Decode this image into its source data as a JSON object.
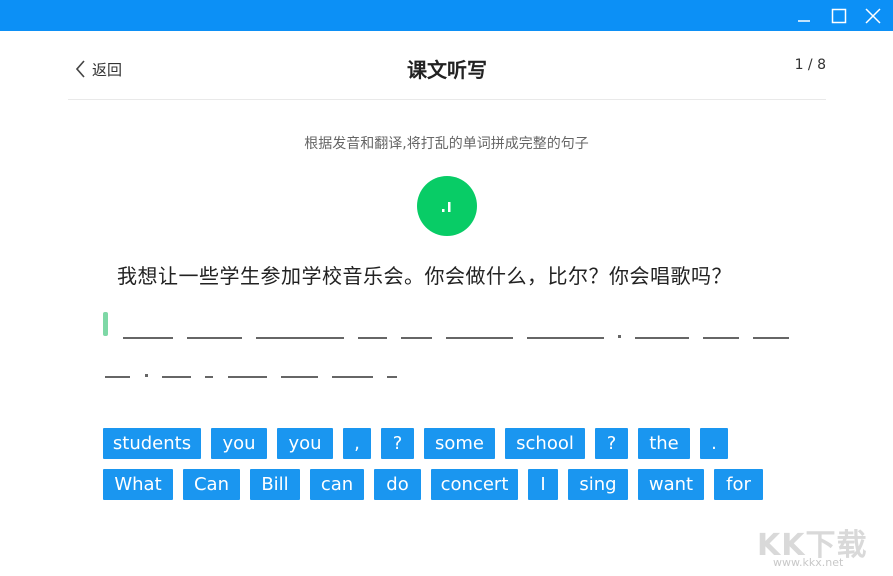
{
  "window": {
    "accent": "#0c90f6"
  },
  "header": {
    "back_label": "返回",
    "title": "课文听写",
    "counter": "1 / 8"
  },
  "instruction": "根据发音和翻译,将打乱的单词拼成完整的句子",
  "sentence": "我想让一些学生参加学校音乐会。你会做什么，比尔？你会唱歌吗？",
  "word_bank": {
    "row1": [
      "students",
      "you",
      "you",
      ",",
      "?",
      "some",
      "school",
      "?",
      "the",
      "."
    ],
    "row2": [
      "What",
      "Can",
      "Bill",
      "can",
      "do",
      "concert",
      "I",
      "sing",
      "want",
      "for"
    ]
  },
  "watermark": {
    "text": "KK下载",
    "url": "www.kkx.net"
  }
}
